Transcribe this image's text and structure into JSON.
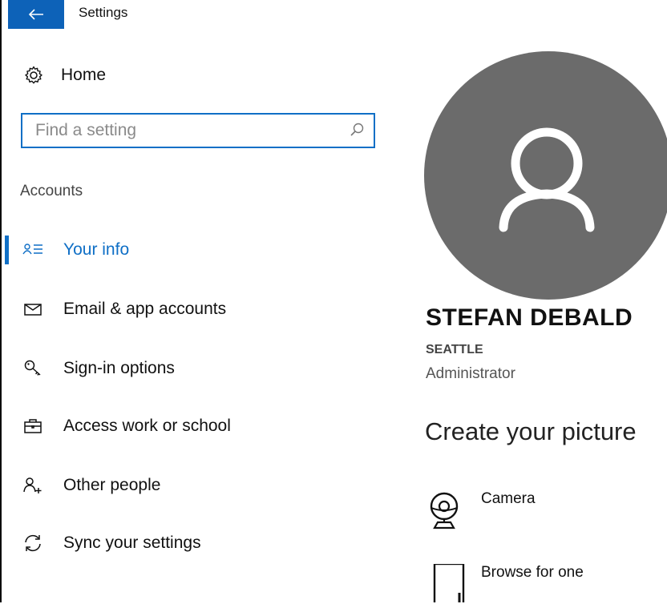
{
  "titlebar": {
    "title": "Settings",
    "back_icon": "back-arrow-icon"
  },
  "nav": {
    "home": {
      "label": "Home",
      "icon": "gear-icon"
    },
    "search": {
      "placeholder": "Find a setting",
      "icon": "search-icon"
    },
    "section": "Accounts",
    "items": [
      {
        "label": "Your info",
        "icon": "person-list-icon",
        "selected": true
      },
      {
        "label": "Email & app accounts",
        "icon": "mail-icon",
        "selected": false
      },
      {
        "label": "Sign-in options",
        "icon": "key-icon",
        "selected": false
      },
      {
        "label": "Access work or school",
        "icon": "briefcase-icon",
        "selected": false
      },
      {
        "label": "Other people",
        "icon": "add-person-icon",
        "selected": false
      },
      {
        "label": "Sync your settings",
        "icon": "sync-icon",
        "selected": false
      }
    ]
  },
  "profile": {
    "name": "STEFAN DEBALD",
    "location": "SEATTLE",
    "role": "Administrator",
    "avatar_icon": "avatar-placeholder-icon"
  },
  "picture": {
    "title": "Create your picture",
    "options": [
      {
        "label": "Camera",
        "icon": "webcam-icon"
      },
      {
        "label": "Browse for one",
        "icon": "file-icon"
      }
    ]
  },
  "colors": {
    "accent": "#0f6fc6",
    "back_button": "#0d62b8",
    "avatar_bg": "#6b6b6b"
  }
}
